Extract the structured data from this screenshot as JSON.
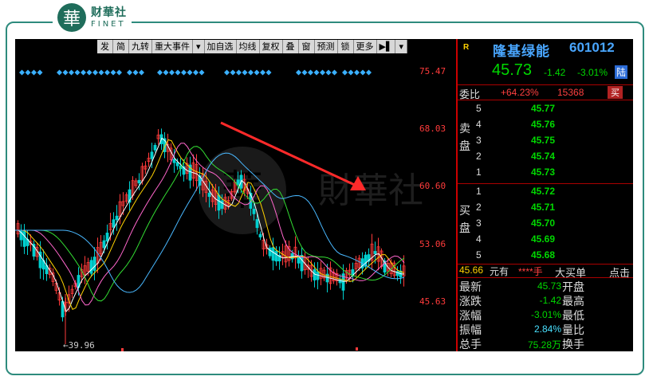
{
  "logo": {
    "mark": "華",
    "cn": "财華社",
    "en": "FINET"
  },
  "watermark": "財華社",
  "toolbar": {
    "items": [
      "发",
      "简",
      "九转",
      "重大事件",
      "▾",
      "加自选",
      "均线",
      "复权",
      "叠",
      "窗",
      "预测",
      "锁",
      "更多",
      "▶▌",
      "▾"
    ]
  },
  "yaxis": {
    "labels": [
      "75.47",
      "68.03",
      "60.60",
      "53.06",
      "45.63"
    ]
  },
  "low_label": "←39.96",
  "stock": {
    "r_tag": "R",
    "name": "隆基绿能",
    "code": "601012",
    "price": "45.73",
    "change": "-1.42",
    "change_pct": "-3.01%",
    "tag": "陆",
    "weibi_label": "委比",
    "weibi_value": "+64.23%",
    "weibi_num": "15368",
    "buy_btn": "买"
  },
  "sell_book": {
    "side": "卖盘",
    "levels": [
      {
        "n": "5",
        "p": "45.77"
      },
      {
        "n": "4",
        "p": "45.76"
      },
      {
        "n": "3",
        "p": "45.75"
      },
      {
        "n": "2",
        "p": "45.74"
      },
      {
        "n": "1",
        "p": "45.73"
      }
    ]
  },
  "buy_book": {
    "side": "买盘",
    "levels": [
      {
        "n": "1",
        "p": "45.72"
      },
      {
        "n": "2",
        "p": "45.71"
      },
      {
        "n": "3",
        "p": "45.70"
      },
      {
        "n": "4",
        "p": "45.69"
      },
      {
        "n": "5",
        "p": "45.68"
      }
    ]
  },
  "trade": {
    "price": "45.66",
    "label": "元有",
    "vol": "****手",
    "type": "大买单",
    "more": "点击"
  },
  "stats": [
    {
      "l": "最新",
      "v": "45.73",
      "r": "开盘",
      "c": "green"
    },
    {
      "l": "涨跌",
      "v": "-1.42",
      "r": "最高",
      "c": "green"
    },
    {
      "l": "涨幅",
      "v": "-3.01%",
      "r": "最低",
      "c": "green"
    },
    {
      "l": "振幅",
      "v": "2.84%",
      "r": "量比",
      "c": "teal"
    },
    {
      "l": "总手",
      "v": "75.28万",
      "r": "换手",
      "c": "green"
    }
  ],
  "colors": {
    "up": "#ff3b3b",
    "down": "#00d0d0",
    "ma5": "#ffffff",
    "ma10": "#ffd200",
    "ma20": "#ff66cc",
    "ma30": "#33dd33",
    "ma60": "#49b8ff",
    "arrow": "#ff2a2a"
  }
}
